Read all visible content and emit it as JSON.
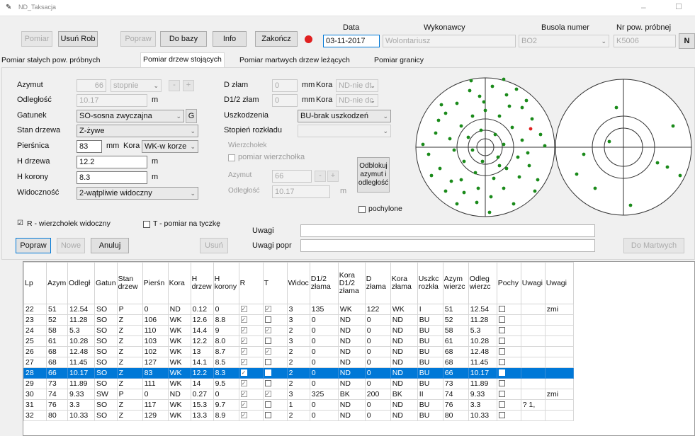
{
  "window": {
    "title": "ND_Taksacja"
  },
  "toolbar": {
    "pomiar": "Pomiar",
    "usun_rob": "Usuń Rob",
    "popraw": "Popraw",
    "do_bazy": "Do bazy",
    "info": "Info",
    "zakoncz": "Zakończ"
  },
  "header": {
    "data_label": "Data",
    "data_value": "03-11-2017",
    "wykonawcy_label": "Wykonawcy",
    "wykonawcy_value": "Wolontariusz",
    "busola_label": "Busola numer",
    "busola_value": "BO2",
    "nr_pow_label": "Nr pow. próbnej",
    "nr_pow_value": "K5006",
    "n_button": "N",
    "status_color": "#e02020"
  },
  "tabs": [
    {
      "label": "Pomiar stałych pow. próbnych"
    },
    {
      "label": "Pomiar drzew stojących"
    },
    {
      "label": "Pomiar martwych drzew leżących"
    },
    {
      "label": "Pomiar granicy"
    }
  ],
  "form": {
    "azymut_label": "Azymut",
    "azymut_value": "66",
    "azymut_unit": "stopnie",
    "minus": "-",
    "plus": "+",
    "odleglosc_label": "Odległość",
    "odleglosc_value": "10.17",
    "odleglosc_unit": "m",
    "gatunek_label": "Gatunek",
    "gatunek_value": "SO-sosna zwyczajna",
    "g_button": "G",
    "stan_label": "Stan drzewa",
    "stan_value": "Z-żywe",
    "piersnica_label": "Pierśnica",
    "piersnica_value": "83",
    "piersnica_unit": "mm",
    "kora_label": "Kora",
    "kora_value": "WK-w korze",
    "h_drzewa_label": "H drzewa",
    "h_drzewa_value": "12.2",
    "h_drzewa_unit": "m",
    "h_korony_label": "H korony",
    "h_korony_value": "8.3",
    "h_korony_unit": "m",
    "widocznosc_label": "Widoczność",
    "widocznosc_value": "2-wątpliwie widoczny",
    "d_zlam_label": "D złam",
    "d_zlam_value": "0",
    "d_zlam_unit": "mm",
    "d_zlam_kora_label": "Kora",
    "d_zlam_kora_value": "ND-nie dt",
    "d12_label": "D1/2 złam",
    "d12_value": "0",
    "d12_unit": "mm",
    "d12_kora_label": "Kora",
    "d12_kora_value": "ND-nie dc",
    "uszkodzenia_label": "Uszkodzenia",
    "uszkodzenia_value": "BU-brak uszkodzeń",
    "stopien_label": "Stopień rozkładu",
    "stopien_value": "",
    "wierzcholek_group": "Wierzchołek",
    "pomiar_wierzch_label": "pomiar wierzchołka",
    "w_azymut_label": "Azymut",
    "w_azymut_value": "66",
    "w_odleglosc_label": "Odległość",
    "w_odleglosc_value": "10.17",
    "w_odleglosc_unit": "m",
    "odblokuj_label": "Odblokuj azymut i odległość",
    "pochylone_label": "pochylone",
    "r_label": "R - wierzchołek widoczny",
    "t_label": "T - pomiar na tyczkę",
    "uwagi_label": "Uwagi",
    "uwagi_value": "",
    "uwagi_popr_label": "Uwagi popr",
    "uwagi_popr_value": "",
    "popraw_btn": "Popraw",
    "nowe_btn": "Nowe",
    "anuluj_btn": "Anuluj",
    "usun_btn": "Usuń",
    "do_martwych_btn": "Do Martwych"
  },
  "grid": {
    "columns": [
      "Lp",
      "Azym",
      "Odległ",
      "Gatun",
      "Stan drzew",
      "Pierśn",
      "Kora",
      "H drzew",
      "H korony",
      "R",
      "T",
      "Widoc",
      "D1/2 złama",
      "Kora D1/2 złama",
      "D złama",
      "Kora złama",
      "Uszkc rozkła",
      "Azym wierzc",
      "Odleg wierzc",
      "Pochy",
      "Uwagi",
      "Uwagi"
    ],
    "rows": [
      [
        "22",
        "51",
        "12.54",
        "SO",
        "P",
        "0",
        "ND",
        "0.12",
        "0",
        "1",
        "1",
        "3",
        "135",
        "WK",
        "122",
        "WK",
        "I",
        "51",
        "12.54",
        "0",
        "",
        "zmi"
      ],
      [
        "23",
        "52",
        "11.28",
        "SO",
        "Z",
        "106",
        "WK",
        "12.6",
        "8.8",
        "1",
        "0",
        "3",
        "0",
        "ND",
        "0",
        "ND",
        "BU",
        "52",
        "11.28",
        "0",
        "",
        ""
      ],
      [
        "24",
        "58",
        "5.3",
        "SO",
        "Z",
        "110",
        "WK",
        "14.4",
        "9",
        "1",
        "1",
        "2",
        "0",
        "ND",
        "0",
        "ND",
        "BU",
        "58",
        "5.3",
        "0",
        "",
        ""
      ],
      [
        "25",
        "61",
        "10.28",
        "SO",
        "Z",
        "103",
        "WK",
        "12.2",
        "8.0",
        "1",
        "0",
        "3",
        "0",
        "ND",
        "0",
        "ND",
        "BU",
        "61",
        "10.28",
        "0",
        "",
        ""
      ],
      [
        "26",
        "68",
        "12.48",
        "SO",
        "Z",
        "102",
        "WK",
        "13",
        "8.7",
        "1",
        "1",
        "2",
        "0",
        "ND",
        "0",
        "ND",
        "BU",
        "68",
        "12.48",
        "0",
        "",
        ""
      ],
      [
        "27",
        "68",
        "11.45",
        "SO",
        "Z",
        "127",
        "WK",
        "14.1",
        "8.5",
        "1",
        "0",
        "2",
        "0",
        "ND",
        "0",
        "ND",
        "BU",
        "68",
        "11.45",
        "0",
        "",
        ""
      ],
      [
        "28",
        "66",
        "10.17",
        "SO",
        "Z",
        "83",
        "WK",
        "12.2",
        "8.3",
        "1",
        "0",
        "2",
        "0",
        "ND",
        "0",
        "ND",
        "BU",
        "66",
        "10.17",
        "0",
        "",
        ""
      ],
      [
        "29",
        "73",
        "11.89",
        "SO",
        "Z",
        "111",
        "WK",
        "14",
        "9.5",
        "1",
        "0",
        "2",
        "0",
        "ND",
        "0",
        "ND",
        "BU",
        "73",
        "11.89",
        "0",
        "",
        ""
      ],
      [
        "30",
        "74",
        "9.33",
        "SW",
        "P",
        "0",
        "ND",
        "0.27",
        "0",
        "1",
        "1",
        "3",
        "325",
        "BK",
        "200",
        "BK",
        "II",
        "74",
        "9.33",
        "0",
        "",
        "zmi"
      ],
      [
        "31",
        "76",
        "3.3",
        "SO",
        "Z",
        "117",
        "WK",
        "15.3",
        "9.7",
        "1",
        "0",
        "1",
        "0",
        "ND",
        "0",
        "ND",
        "BU",
        "76",
        "3.3",
        "0",
        "? 1,",
        ""
      ],
      [
        "32",
        "80",
        "10.33",
        "SO",
        "Z",
        "129",
        "WK",
        "13.3",
        "8.9",
        "1",
        "0",
        "2",
        "0",
        "ND",
        "0",
        "ND",
        "BU",
        "80",
        "10.33",
        "0",
        "",
        ""
      ]
    ],
    "selected_row": 6
  },
  "plot_left": {
    "marker_color": "#1a8a1a",
    "highlight_color": "#e02020"
  },
  "plot_right": {
    "marker_color": "#1a8a1a"
  }
}
